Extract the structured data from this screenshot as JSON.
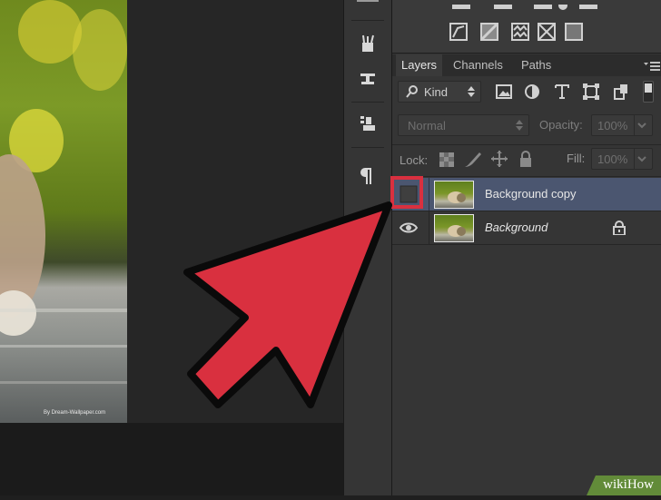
{
  "layers_panel": {
    "tabs": [
      {
        "label": "Layers",
        "active": true
      },
      {
        "label": "Channels",
        "active": false
      },
      {
        "label": "Paths",
        "active": false
      }
    ],
    "filter_kind": "Kind",
    "blend_mode": "Normal",
    "opacity_label": "Opacity:",
    "opacity_value": "100%",
    "lock_label": "Lock:",
    "fill_label": "Fill:",
    "fill_value": "100%",
    "layers": [
      {
        "name": "Background copy",
        "visible": false,
        "selected": true,
        "locked": false,
        "italic": false
      },
      {
        "name": "Background",
        "visible": true,
        "selected": false,
        "locked": true,
        "italic": true
      }
    ]
  },
  "canvas": {
    "photo_caption": "By Dream-Wallpaper.com"
  },
  "watermark": "wikiHow",
  "colors": {
    "highlight": "#d9303f",
    "selected_row": "#4b5670",
    "panel": "#353535",
    "watermark_green": "#6a9a3a"
  }
}
